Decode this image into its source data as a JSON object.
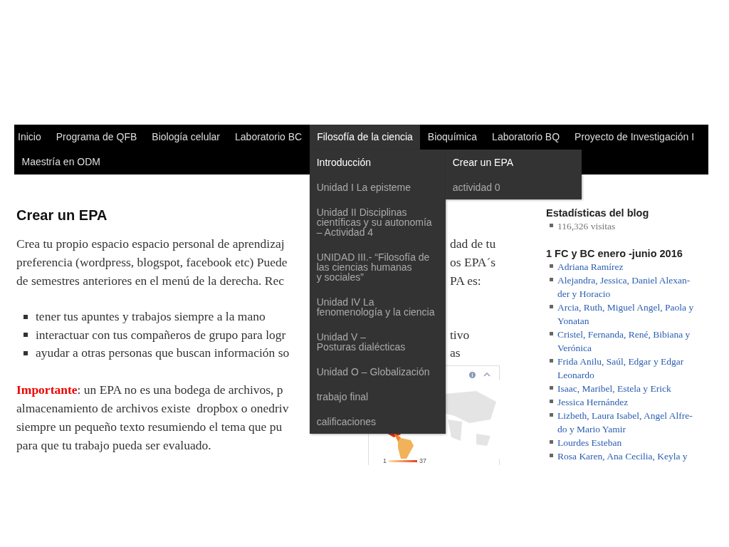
{
  "nav": {
    "items": [
      {
        "label": "Inicio",
        "selected": false
      },
      {
        "label": "Programa de QFB",
        "selected": false
      },
      {
        "label": "Biología celular",
        "selected": false
      },
      {
        "label": "Laboratorio BC",
        "selected": false
      },
      {
        "label": "Filosofía de la ciencia",
        "selected": true,
        "dropdown": [
          {
            "label": "Introducción",
            "highlighted": true,
            "submenu": [
              {
                "label": "Crear un EPA",
                "highlighted": true
              },
              {
                "label": "actividad 0",
                "highlighted": false
              }
            ]
          },
          {
            "label": "Unidad I La episteme",
            "highlighted": false
          },
          {
            "label": "Unidad II Disciplinas\ncientíficas y su autonomía\n– Actividad 4",
            "highlighted": false
          },
          {
            "label": "UNIDAD III.- “Filosofía de\nlas ciencias humanas\ny sociales”",
            "highlighted": false
          },
          {
            "label": "Unidad IV La\nfenomenología y la ciencia",
            "highlighted": false
          },
          {
            "label": "Unidad V –\nPosturas dialécticas",
            "highlighted": false
          },
          {
            "label": "Unidad O – Globalización",
            "highlighted": false
          },
          {
            "label": "trabajo final",
            "highlighted": false
          },
          {
            "label": "calificaciones",
            "highlighted": false
          }
        ]
      },
      {
        "label": "Bioquímica",
        "selected": false
      },
      {
        "label": "Laboratorio BQ",
        "selected": false
      },
      {
        "label": "Proyecto de Investigación I",
        "selected": false
      },
      {
        "label": "Maestría en ODM",
        "selected": false
      }
    ]
  },
  "main": {
    "title": "Crear un EPA",
    "intro_lines": [
      {
        "left": "Crea tu propio espacio espacio personal de aprendizaj",
        "right": "dad de tu"
      },
      {
        "left": "preferencia (wordpress, blogspot, facebook etc) Puede",
        "right": "os EPA´s"
      },
      {
        "left": "de semestres anteriores en el menú de la derecha. Rec",
        "right": "PA es:"
      }
    ],
    "bullets": [
      {
        "left": "tener tus apuntes y trabajos siempre a la mano"
      },
      {
        "left": "interactuar con tus compañeros de grupo para logr",
        "right": "tivo"
      },
      {
        "left": "ayudar a otras personas que buscan información so",
        "right": "as"
      }
    ],
    "important_lines": [
      {
        "left": "**Importante**: un EPA no es una bodega de archivos, p"
      },
      {
        "left": "almacenamiento de archivos existe  dropbox o onedriv"
      },
      {
        "left": "siempre un pequeño texto resumiendo el tema que pu"
      },
      {
        "left": "para que tu trabajo pueda ser evaluado."
      }
    ],
    "map_widget": {
      "legend_min": "1",
      "legend_max": "37"
    }
  },
  "sidebar": {
    "stats": {
      "title": "Estadísticas del blog",
      "items": [
        "116,326 visitas"
      ]
    },
    "group": {
      "title": "1 FC y BC enero -junio 2016",
      "links": [
        "Adriana Ramírez",
        "Alejandra, Jessica, Daniel Alexan-\nder y Horacio",
        "Arcia, Ruth, Miguel Angel, Paola y\nYonatan",
        "Cristel, Fernanda, René, Bibiana y\nVerónica",
        "Frida Anilu, Saúl, Edgar y Edgar\nLeonardo",
        "Isaac, Maribel, Estela y Erick",
        "Jessica Hernández",
        "Lizbeth, Laura Isabel, Angel Alfre-\ndo y Mario Yamir",
        "Lourdes Esteban",
        "Rosa Karen, Ana Cecilia, Keyla y"
      ]
    }
  }
}
